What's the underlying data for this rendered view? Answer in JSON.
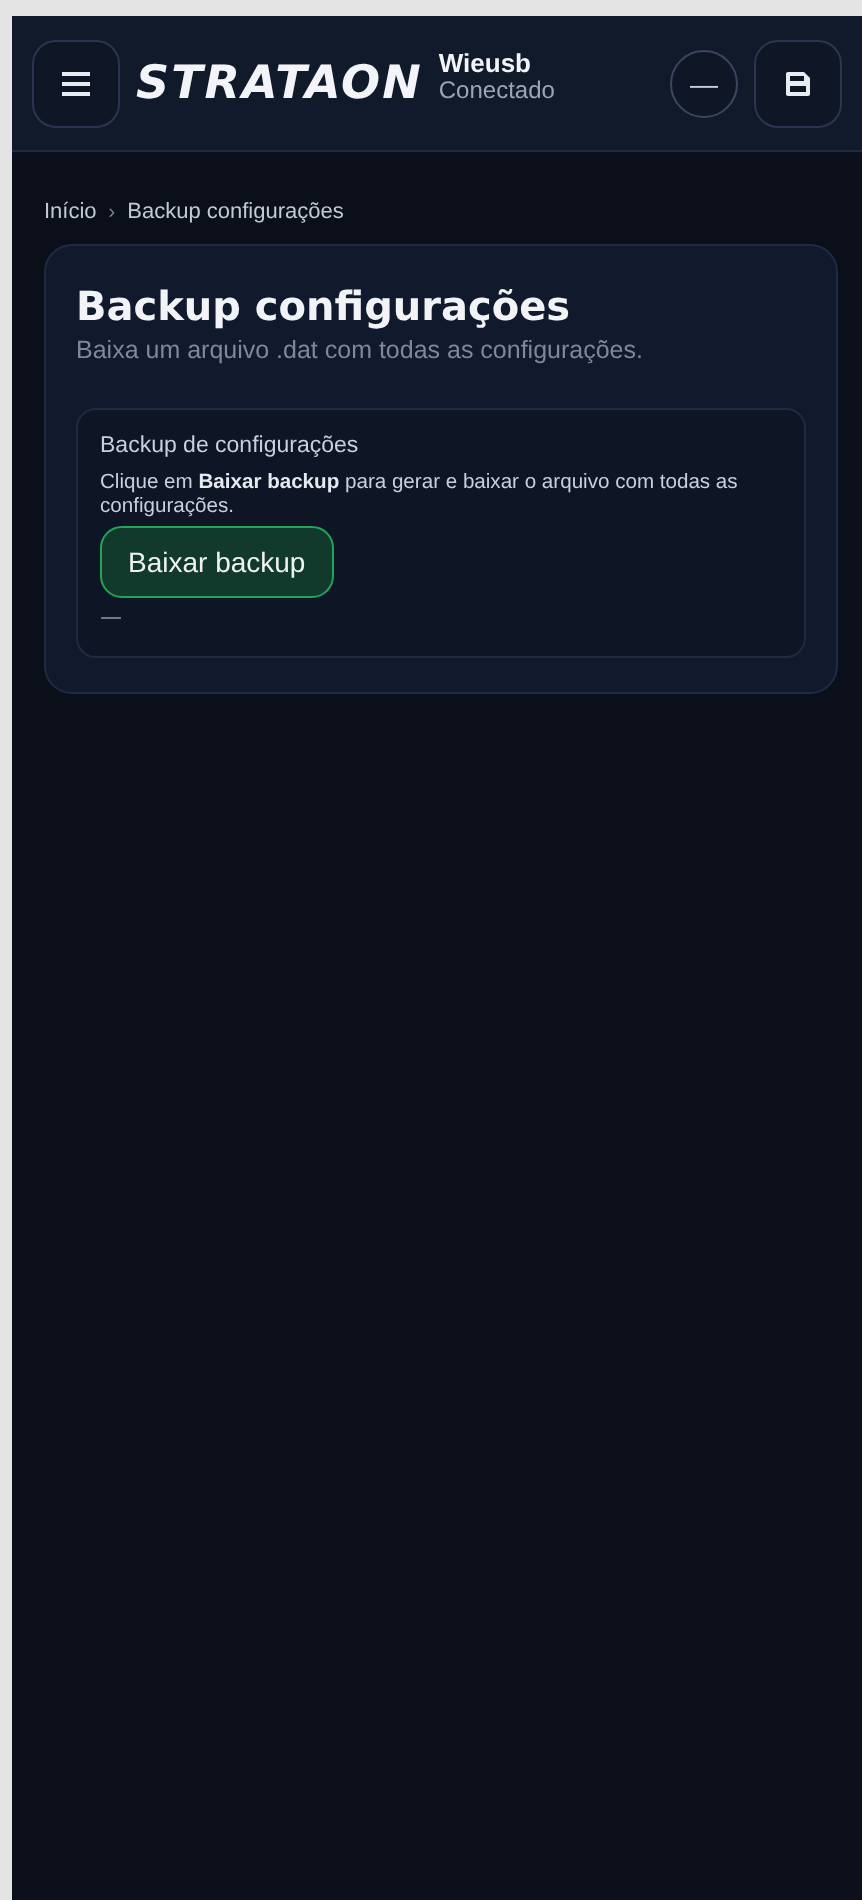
{
  "header": {
    "logo": "STRATAON",
    "device_name": "Wieusb",
    "device_status": "Conectado",
    "status_button": "—"
  },
  "breadcrumb": [
    "Início",
    "Backup configurações"
  ],
  "breadcrumb_separator": "›",
  "card": {
    "title": "Backup configurações",
    "subtitle": "Baixa um arquivo .dat com todas as configurações.",
    "section": {
      "title": "Backup de configurações",
      "description": "Clique em **Baixar backup** para gerar e baixar o arquivo com todas as configurações.",
      "button": "Baixar backup",
      "result": "—"
    }
  }
}
